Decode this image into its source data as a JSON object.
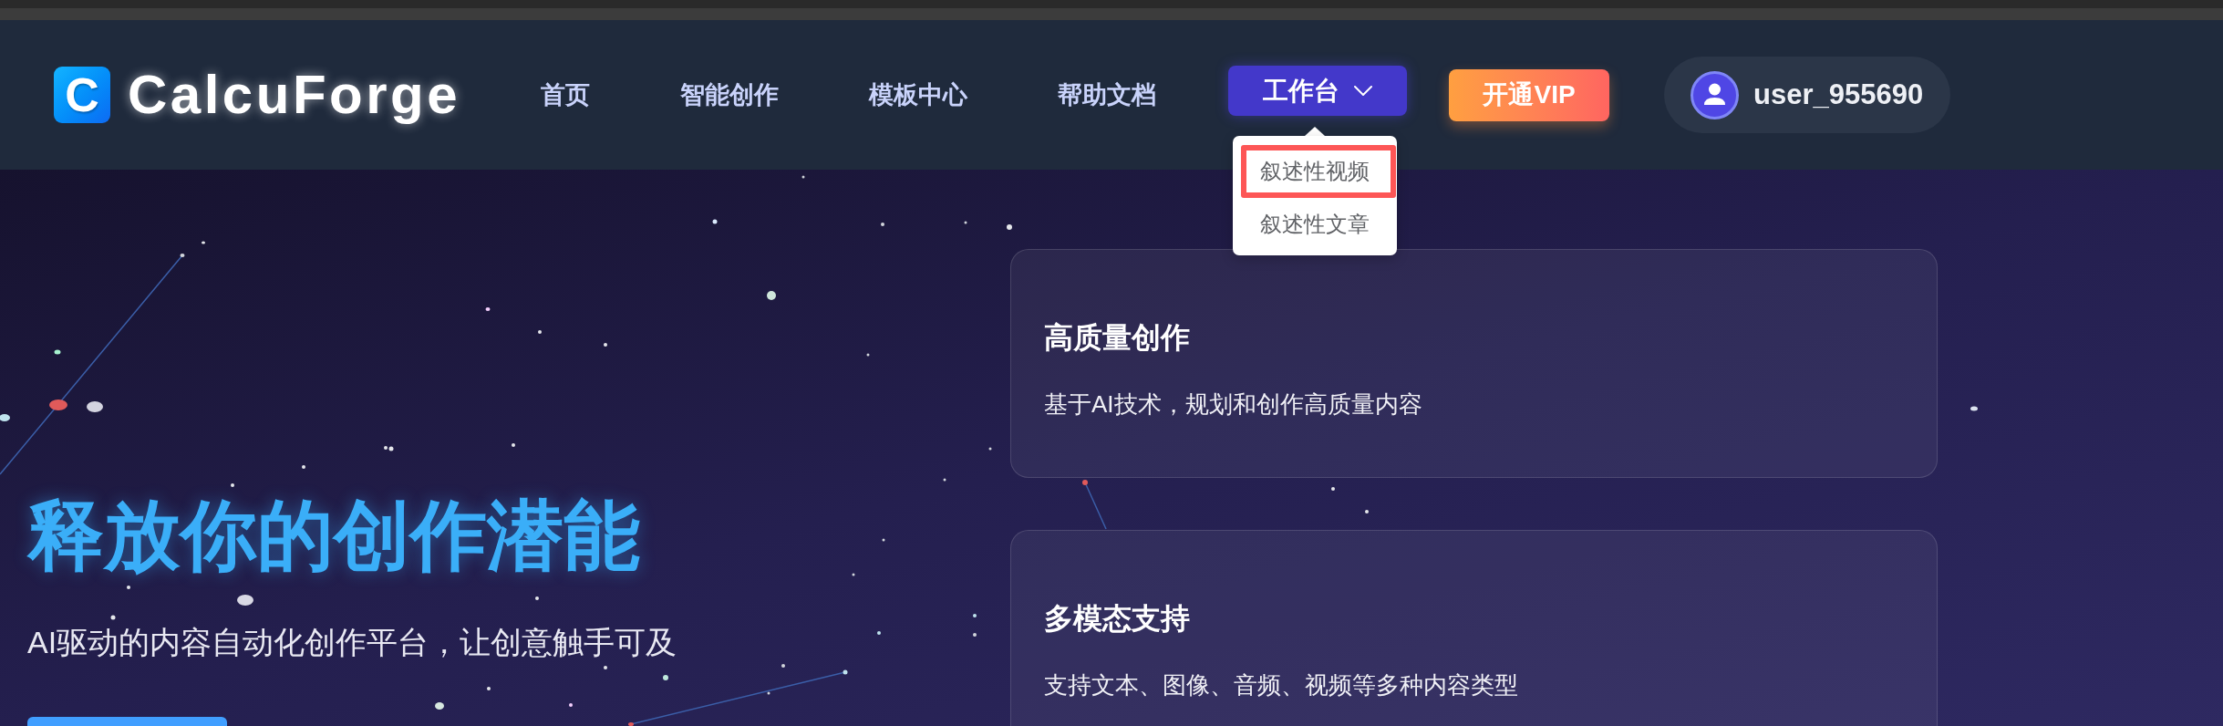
{
  "header": {
    "logo": {
      "letter": "C",
      "name": "CalcuForge"
    },
    "nav": [
      "首页",
      "智能创作",
      "模板中心",
      "帮助文档"
    ],
    "workbench": {
      "label": "工作台",
      "expanded": true,
      "menu": [
        {
          "label": "叙述性视频",
          "selected": true
        },
        {
          "label": "叙述性文章",
          "selected": false
        }
      ]
    },
    "vip_button": "开通VIP",
    "user": {
      "name": "user_955690"
    }
  },
  "hero": {
    "title": "释放你的创作潜能",
    "subtitle": "AI驱动的内容自动化创作平台，让创意触手可及",
    "cards": [
      {
        "title": "高质量创作",
        "description": "基于AI技术，规划和创作高质量内容"
      },
      {
        "title": "多模态支持",
        "description": "支持文本、图像、音频、视频等多种内容类型"
      }
    ]
  }
}
